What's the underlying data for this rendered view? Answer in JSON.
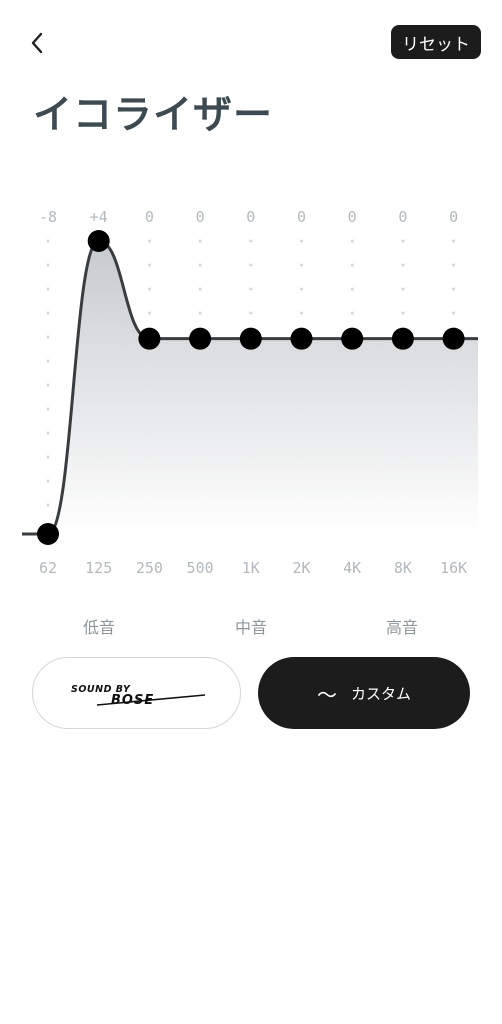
{
  "header": {
    "back_icon": "chevron-left-icon",
    "reset_label": "リセット"
  },
  "title": "イコライザー",
  "equalizer": {
    "bands": [
      {
        "freq": "62",
        "value_label": "-8",
        "gain": -8
      },
      {
        "freq": "125",
        "value_label": "+4",
        "gain": 4
      },
      {
        "freq": "250",
        "value_label": "0",
        "gain": 0
      },
      {
        "freq": "500",
        "value_label": "0",
        "gain": 0
      },
      {
        "freq": "1K",
        "value_label": "0",
        "gain": 0
      },
      {
        "freq": "2K",
        "value_label": "0",
        "gain": 0
      },
      {
        "freq": "4K",
        "value_label": "0",
        "gain": 0
      },
      {
        "freq": "8K",
        "value_label": "0",
        "gain": 0
      },
      {
        "freq": "16K",
        "value_label": "0",
        "gain": 0
      }
    ],
    "gain_range": [
      -8,
      4
    ]
  },
  "ranges": {
    "low": "低音",
    "mid": "中音",
    "high": "高音"
  },
  "presets": {
    "bose_logo_text": "SOUND BY BOSE",
    "custom_icon": "wave-icon",
    "custom_label": "カスタム"
  },
  "colors": {
    "accent_dark": "#1c1c1c",
    "title": "#3d4a52",
    "muted": "#b3b9be"
  }
}
